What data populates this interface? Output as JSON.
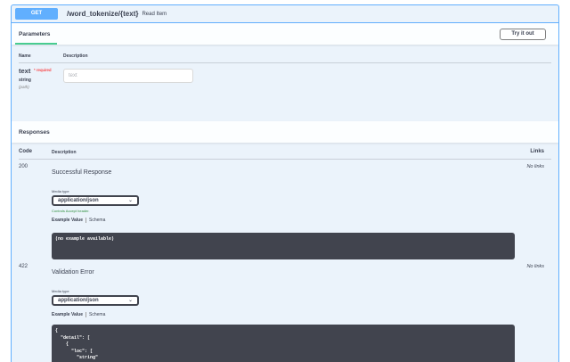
{
  "operation": {
    "method": "GET",
    "path": "/word_tokenize/{text}",
    "summary": "Read Item"
  },
  "parameters": {
    "title": "Parameters",
    "try_button": "Try it out",
    "col_name": "Name",
    "col_description": "Description",
    "items": [
      {
        "name": "text",
        "required": "* required",
        "type": "string",
        "in": "(path)",
        "placeholder": "text"
      }
    ]
  },
  "responses": {
    "title": "Responses",
    "col_code": "Code",
    "col_description": "Description",
    "col_links": "Links",
    "items": [
      {
        "code": "200",
        "description": "Successful Response",
        "media_type_label": "Media type",
        "media_type": "application/json",
        "controls_accept": "Controls Accept header.",
        "tab_example": "Example Value",
        "tab_schema": "Schema",
        "example_text": "(no example available)",
        "links": "No links"
      },
      {
        "code": "422",
        "description": "Validation Error",
        "media_type_label": "Media type",
        "media_type": "application/json",
        "tab_example": "Example Value",
        "tab_schema": "Schema",
        "example_lines": [
          "{",
          "  \"detail\": [",
          "    {",
          "      \"loc\": [",
          "        \"string\"",
          "      ],"
        ],
        "links": "No links"
      }
    ]
  },
  "colors": {
    "get_accent": "#61affe",
    "get_background": "#ebf3fb",
    "example_background": "#41444e",
    "required": "#ff0000",
    "tab_underline": "#49cc90"
  }
}
